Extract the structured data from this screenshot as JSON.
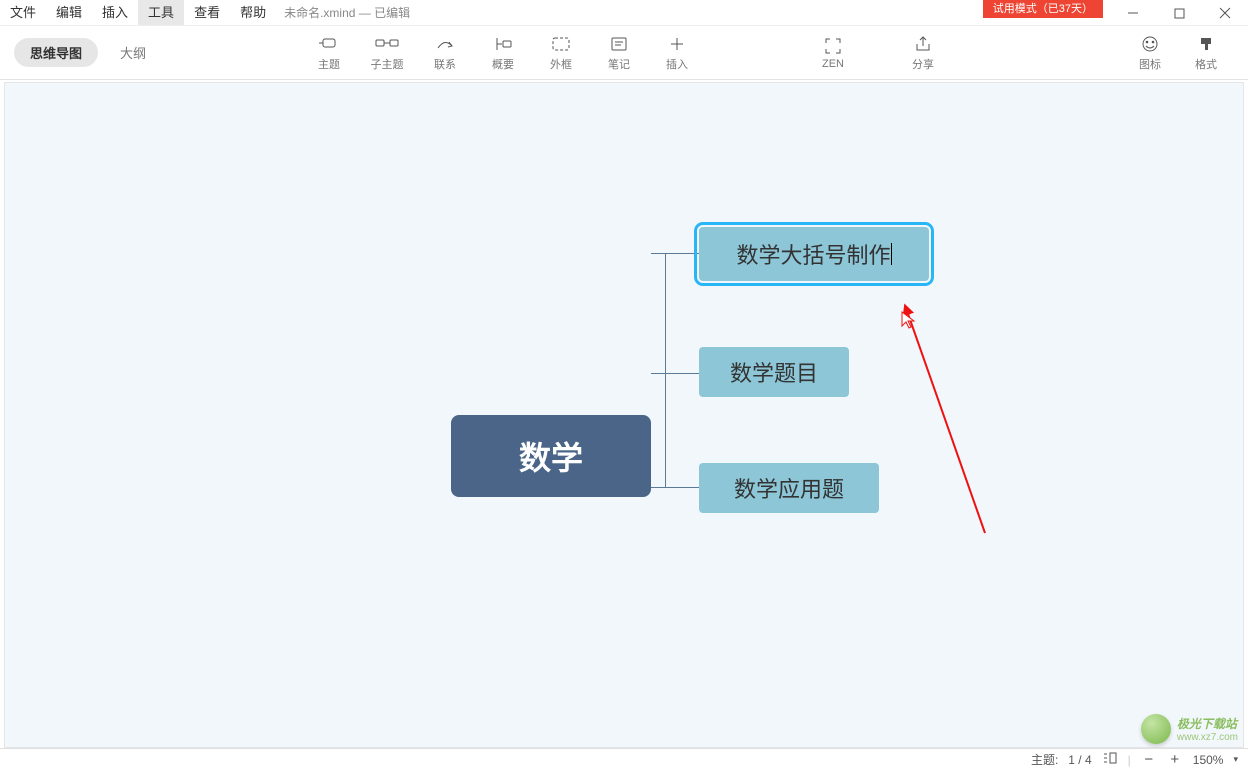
{
  "menu": {
    "items": [
      "文件",
      "编辑",
      "插入",
      "工具",
      "查看",
      "帮助"
    ],
    "activeIndex": 3,
    "docTitle": "未命名.xmind  — 已编辑"
  },
  "trial": "试用模式（已37天）",
  "viewTabs": {
    "mindmap": "思维导图",
    "outline": "大纲"
  },
  "tools": [
    {
      "id": "topic",
      "label": "主题",
      "icon": "topic"
    },
    {
      "id": "subtopic",
      "label": "子主题",
      "icon": "subtopic"
    },
    {
      "id": "relation",
      "label": "联系",
      "icon": "relation"
    },
    {
      "id": "summary",
      "label": "概要",
      "icon": "summary"
    },
    {
      "id": "boundary",
      "label": "外框",
      "icon": "boundary"
    },
    {
      "id": "note",
      "label": "笔记",
      "icon": "note"
    },
    {
      "id": "insert",
      "label": "插入",
      "icon": "insert"
    }
  ],
  "midTools": {
    "zen": "ZEN",
    "share": "分享"
  },
  "rightTools": {
    "icons": "图标",
    "format": "格式"
  },
  "nodes": {
    "central": "数学",
    "children": [
      "数学大括号制作",
      "数学题目",
      "数学应用题"
    ],
    "selectedIndex": 0
  },
  "status": {
    "topicLabel": "主题:",
    "topicCount": "1 / 4",
    "zoom": "150%"
  },
  "watermark": {
    "main": "极光下载站",
    "sub": "www.xz7.com"
  },
  "colors": {
    "accent": "#29b6f6",
    "central": "#4a6587",
    "sub": "#8cc6d7"
  }
}
